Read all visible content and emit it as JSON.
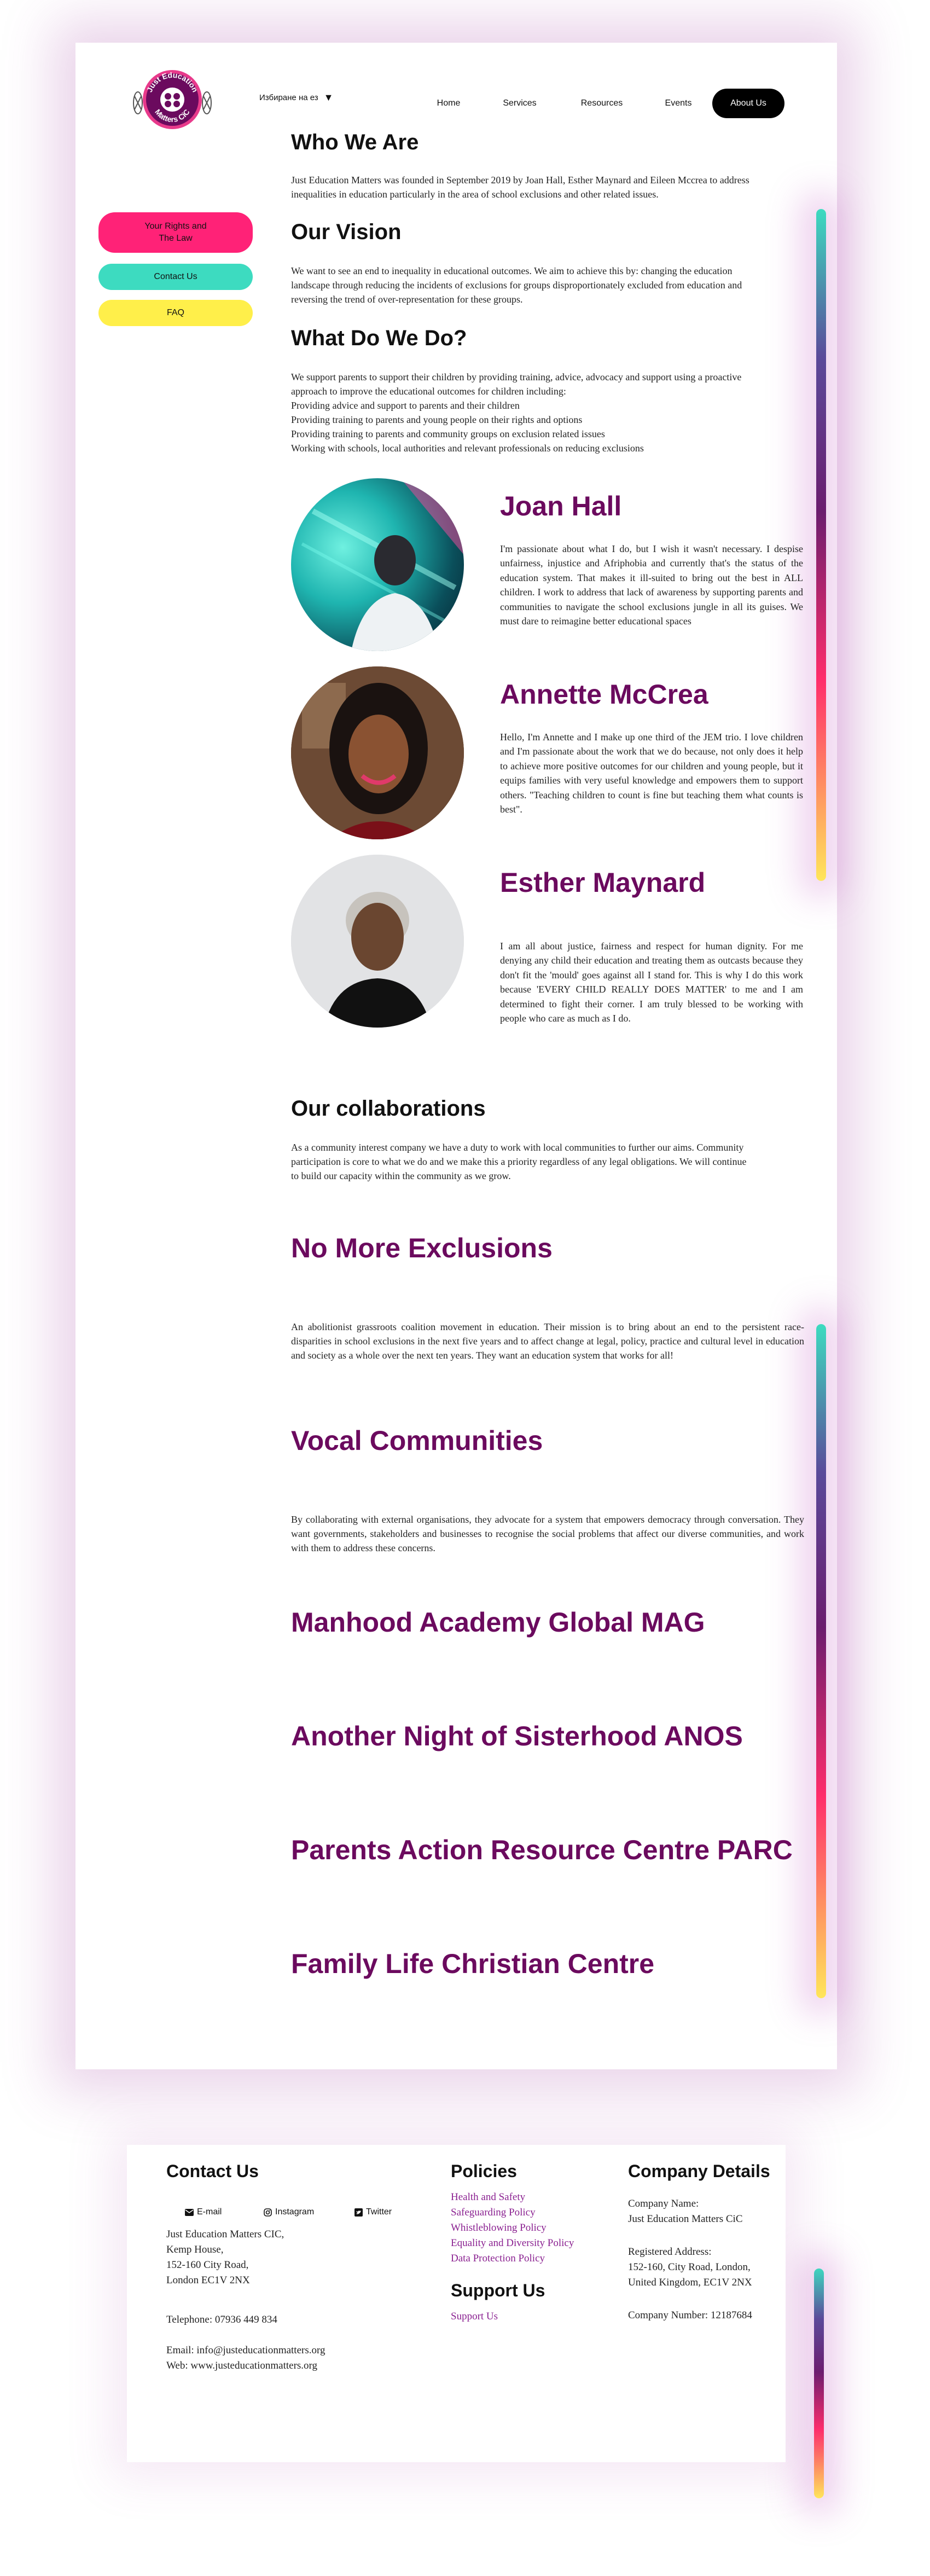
{
  "header": {
    "language_label": "Избиране на ез",
    "nav": [
      "Home",
      "Services",
      "Resources",
      "Events",
      "About Us"
    ],
    "active_nav": "About Us"
  },
  "side_menu": {
    "rights": "Your Rights and The Law",
    "contact": "Contact Us",
    "faq": "FAQ"
  },
  "who_we_are": {
    "title": "Who We Are",
    "lines": [
      "Just Education Matters was founded in September 2019 by Joan Hall, Esther Maynard and Eileen Mccrea to address",
      "inequalities in education particularly in the area of school exclusions and other related issues."
    ]
  },
  "our_vision": {
    "title": "Our Vision",
    "lines": [
      "We want to see an end to inequality in educational outcomes. We aim to achieve this by: changing the education",
      "landscape through reducing the incidents of exclusions for groups disproportionately excluded from education and",
      "reversing the trend of over-representation for these groups."
    ]
  },
  "what_we_do": {
    "title": "What Do We Do?",
    "lines": [
      "We support parents to support their children by providing training, advice, advocacy and support using a proactive",
      "approach to improve the educational outcomes for children including:",
      "Providing advice and support to parents and their children",
      "Providing training to parents and young people on their rights and options",
      "Providing training to parents and community groups on exclusion related issues",
      "Working with schools, local authorities and relevant professionals on reducing exclusions"
    ]
  },
  "people": [
    {
      "name": "Joan Hall",
      "bio": "I'm passionate about what I do, but I wish it wasn't necessary. I despise unfairness, injustice and Afriphobia and currently that's the status of the education system. That makes it ill-suited to bring out the best in ALL children. I work to address that lack of awareness by supporting parents and communities to navigate the school exclusions jungle in all its guises. We must dare to reimagine better educational spaces"
    },
    {
      "name": "Annette McCrea",
      "bio": "Hello, I'm Annette and I make up one third of the JEM trio. I love children and I'm passionate about the work that we do because, not only does it help to achieve more positive outcomes for our children and young people, but it equips families with very useful knowledge and empowers them to support others. \"Teaching children to count is fine but teaching them what counts is best\"."
    },
    {
      "name": "Esther Maynard",
      "bio": "I am all about justice, fairness and respect for human dignity. For me denying any child their education and treating them as outcasts because they don't fit the 'mould' goes against all I stand for. This is why I do this work because 'EVERY CHILD REALLY DOES MATTER' to me and I am determined to fight their corner. I am truly blessed to be working with people who care as much as I do."
    }
  ],
  "collaborations": {
    "title": "Our collaborations",
    "lines": [
      "As a community interest company we have a duty to work with local communities to further our aims. Community",
      "participation is core to what we do and we make this a priority regardless of any legal obligations. We will continue",
      "to build our capacity within the community as we grow."
    ]
  },
  "orgs": [
    {
      "name": "No More Exclusions",
      "desc": "An abolitionist grassroots coalition movement in education. Their mission is to bring about an end to the persistent race-disparities in school exclusions in the next five years and to affect change at legal, policy, practice and cultural level in education and society as a whole over the next ten years. They want an education system that works for all!"
    },
    {
      "name": "Vocal Communities",
      "desc": "By collaborating with external organisations, they advocate for a system that empowers democracy through conversation. They want governments, stakeholders and businesses to recognise the social problems that affect our diverse communities, and work with them to address these concerns."
    },
    {
      "name": "Manhood Academy Global MAG"
    },
    {
      "name": "Another Night of Sisterhood ANOS"
    },
    {
      "name": "Parents Action Resource Centre PARC"
    },
    {
      "name": "Family Life Christian Centre"
    }
  ],
  "footer": {
    "contact": {
      "title": "Contact Us",
      "social": [
        "E-mail",
        "Instagram",
        "Twitter"
      ],
      "address": [
        "Just Education Matters CIC,",
        "Kemp House,",
        "152-160 City Road,",
        "London EC1V 2NX"
      ],
      "telephone": "Telephone: 07936 449 834",
      "email": "Email: info@justeducationmatters.org",
      "web": "Web: www.justeducationmatters.org"
    },
    "policies": {
      "title": "Policies",
      "links": [
        "Health and Safety",
        "Safeguarding Policy",
        "Whistleblowing Policy",
        "Equality and Diversity Policy",
        "Data Protection Policy"
      ]
    },
    "support": {
      "title": "Support Us",
      "link": "Support Us"
    },
    "company": {
      "title": "Company Details",
      "name_label": "Company Name:",
      "name": "Just Education Matters CiC",
      "address_label": "Registered Address:",
      "address": [
        "152-160, City Road, London,",
        "United Kingdom, EC1V 2NX"
      ],
      "number": "Company Number: 12187684"
    }
  },
  "colors": {
    "accent_purple": "#6b0a5e",
    "pink": "#ff2277",
    "teal": "#3ddbc0",
    "yellow": "#ffef4a",
    "link": "#8a2090"
  }
}
